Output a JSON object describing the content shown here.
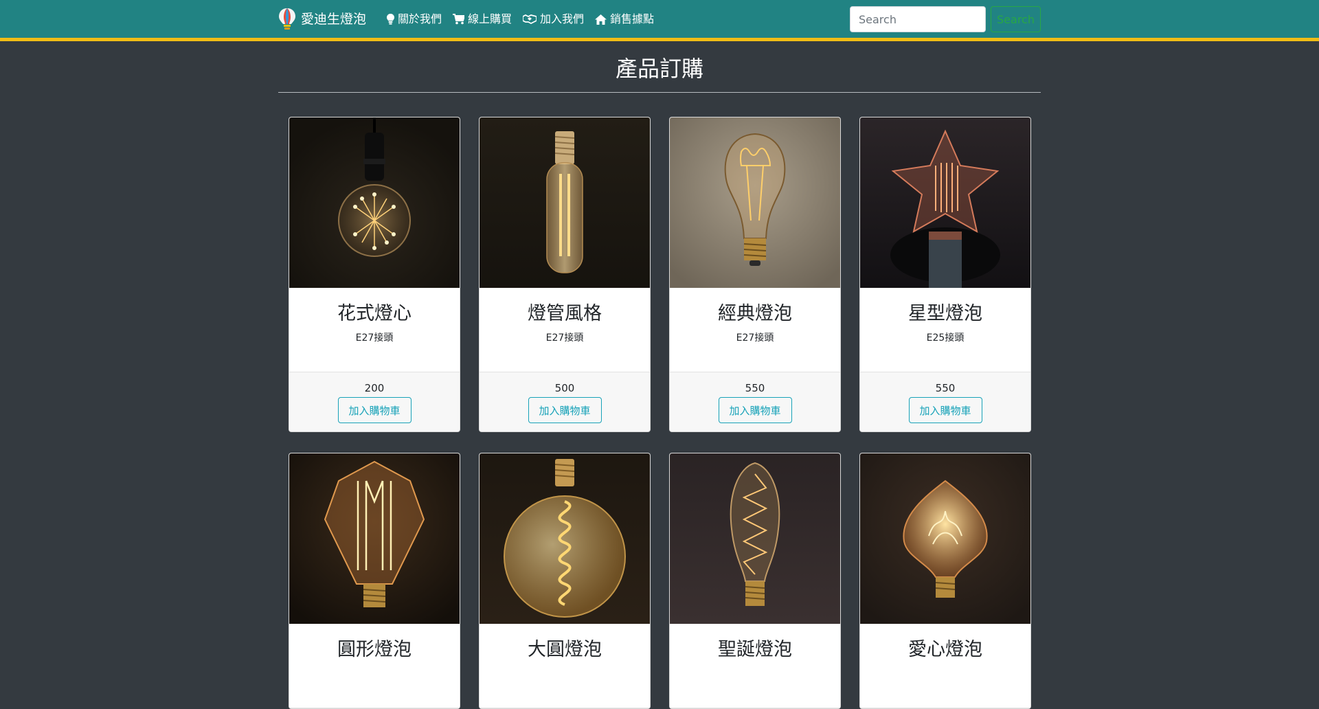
{
  "navbar": {
    "brand": "愛迪生燈泡",
    "links": [
      {
        "label": "關於我們",
        "icon": "lightbulb-icon"
      },
      {
        "label": "線上購買",
        "icon": "shopping-cart-icon"
      },
      {
        "label": "加入我們",
        "icon": "handshake-icon"
      },
      {
        "label": "銷售據點",
        "icon": "home-icon"
      }
    ],
    "search_placeholder": "Search",
    "search_button": "Search",
    "colors": {
      "background": "#218383",
      "border": "#f0bd16"
    }
  },
  "page": {
    "title": "產品訂購",
    "background": "#343a40"
  },
  "products": [
    {
      "name": "花式燈心",
      "socket": "E27接頭",
      "price": "200",
      "button": "加入購物車",
      "image_icon": "starburst-globe-bulb-icon"
    },
    {
      "name": "燈管風格",
      "socket": "E27接頭",
      "price": "500",
      "button": "加入購物車",
      "image_icon": "tube-bulb-icon"
    },
    {
      "name": "經典燈泡",
      "socket": "E27接頭",
      "price": "550",
      "button": "加入購物車",
      "image_icon": "classic-bulb-icon"
    },
    {
      "name": "星型燈泡",
      "socket": "E25接頭",
      "price": "550",
      "button": "加入購物車",
      "image_icon": "star-bulb-icon"
    },
    {
      "name": "圓形燈泡",
      "image_icon": "diamond-bulb-icon"
    },
    {
      "name": "大圓燈泡",
      "image_icon": "big-globe-bulb-icon"
    },
    {
      "name": "聖誕燈泡",
      "image_icon": "christmas-bulb-icon"
    },
    {
      "name": "愛心燈泡",
      "image_icon": "heart-bulb-icon"
    }
  ]
}
